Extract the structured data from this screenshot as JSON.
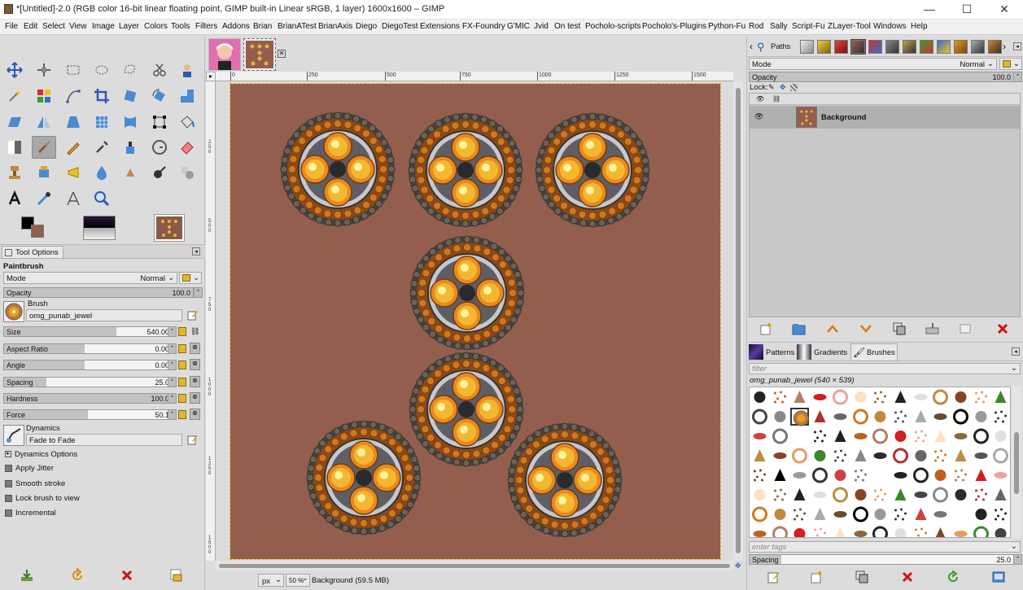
{
  "window": {
    "title": "*[Untitled]-2.0 (RGB color 16-bit linear floating point, GIMP built-in Linear sRGB, 1 layer) 1600x1600 – GIMP",
    "minimize": "—",
    "maximize": "☐",
    "close": "✕"
  },
  "menu": [
    "File",
    "Edit",
    "Select",
    "View",
    "Image",
    "Layer",
    "Colors",
    "Tools",
    "Filters",
    "Addons",
    "Brian",
    "BrianATest",
    "BrianAxis",
    "Diego",
    "DiegoTest",
    "Extensions",
    "FX-Foundry",
    "G'MIC",
    "Jvid",
    "On test",
    "Pocholo-scripts",
    "Pocholo's-Plugins",
    "Python-Fu",
    "Rod",
    "Sally",
    "Script-Fu",
    "ZLayer-Tool",
    "Windows",
    "Help"
  ],
  "toolbox": {
    "tool_options_tab": "Tool Options",
    "tool_name": "Paintbrush",
    "mode_label": "Mode",
    "mode_value": "Normal",
    "opacity_label": "Opacity",
    "opacity_value": "100.0",
    "brush_label": "Brush",
    "brush_name": "omg_punab_jewel",
    "size_label": "Size",
    "size_value": "540.00",
    "aspect_label": "Aspect Ratio",
    "aspect_value": "0.00",
    "angle_label": "Angle",
    "angle_value": "0.00",
    "spacing_label": "Spacing",
    "spacing_value": "25.0",
    "hardness_label": "Hardness",
    "hardness_value": "100.0",
    "force_label": "Force",
    "force_value": "50.1",
    "dynamics_label": "Dynamics",
    "dynamics_value": "Fade to Fade",
    "dynamics_options": "Dynamics Options",
    "apply_jitter": "Apply Jitter",
    "smooth_stroke": "Smooth stroke",
    "lock_brush": "Lock brush to view",
    "incremental": "Incremental",
    "fg_color": "#000000",
    "bg_color": "#935e4e"
  },
  "ruler": {
    "h_ticks": [
      "0",
      "250",
      "500",
      "750",
      "1000",
      "1250",
      "1500"
    ],
    "v_ticks": [
      "2\n5\n0",
      "5\n0\n0",
      "7\n5\n0",
      "1\n0\n0\n0",
      "1\n2\n5\n0",
      "1\n5\n0\n0"
    ]
  },
  "statusbar": {
    "unit": "px",
    "zoom": "50 %",
    "info": "Background (59.5 MB)"
  },
  "layers": {
    "paths_tab": "Paths",
    "mode_label": "Mode",
    "mode_value": "Normal",
    "opacity_label": "Opacity",
    "opacity_value": "100.0",
    "lock_label": "Lock:",
    "layer_name": "Background"
  },
  "brushes": {
    "patterns_tab": "Patterns",
    "gradients_tab": "Gradients",
    "brushes_tab": "Brushes",
    "filter_placeholder": "filter",
    "current_brush": "omg_punab_jewel (540 × 539)",
    "tags_placeholder": "enter tags",
    "spacing_label": "Spacing",
    "spacing_value": "25.0"
  },
  "colors": {
    "canvas": "#935e4e",
    "panel": "#dcdcdc",
    "selection": "#a8a8a8"
  }
}
